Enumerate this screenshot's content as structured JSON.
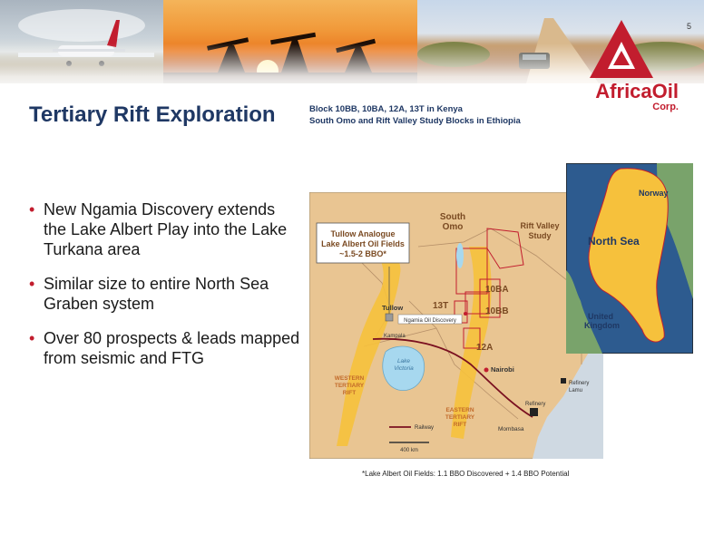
{
  "page": {
    "number": "5"
  },
  "logo": {
    "name_part1": "Africa",
    "name_part2": "Oil",
    "suffix": "Corp."
  },
  "header": {
    "title": "Tertiary Rift Exploration",
    "subtitle_line1": "Block 10BB, 10BA, 12A, 13T in Kenya",
    "subtitle_line2": "South Omo and Rift Valley Study Blocks in Ethiopia"
  },
  "bullets": [
    {
      "text": "New Ngamia Discovery extends the Lake Albert Play into the Lake Turkana area"
    },
    {
      "text": "Similar size to entire North Sea Graben system"
    },
    {
      "text": "Over 80 prospects & leads mapped from seismic and FTG"
    }
  ],
  "map": {
    "callout_line1": "Tullow Analogue",
    "callout_line2": "Lake Albert Oil Fields",
    "callout_line3": "~1.5-2 BBO*",
    "south_omo_1": "South",
    "south_omo_2": "Omo",
    "rift_valley_1": "Rift Valley",
    "rift_valley_2": "Study",
    "block_10ba": "10BA",
    "block_10bb": "10BB",
    "block_13t": "13T",
    "block_12a": "12A",
    "tullow": "Tullow",
    "ngamia": "Ngamia Oil Discovery",
    "kampala": "Kampala",
    "lake_victoria_1": "Lake",
    "lake_victoria_2": "Victoria",
    "nairobi": "Nairobi",
    "western_rift_1": "WESTERN",
    "western_rift_2": "TERTIARY",
    "western_rift_3": "RIFT",
    "eastern_rift_1": "EASTERN",
    "eastern_rift_2": "TERTIARY",
    "eastern_rift_3": "RIFT",
    "refinery_lamu_1": "Refinery",
    "refinery_lamu_2": "Lamu",
    "refinery_mombasa": "Refinery",
    "mombasa": "Mombasa",
    "railway": "Railway",
    "scale": "400 km"
  },
  "inset": {
    "norway": "Norway",
    "north_sea": "North Sea",
    "uk_1": "United",
    "uk_2": "Kingdom"
  },
  "footnote": "*Lake Albert Oil Fields:  1.1 BBO Discovered + 1.4 BBO Potential",
  "colors": {
    "title": "#1f3864",
    "brand": "#c21d2e",
    "basin": "#f6c13c",
    "land": "#e9c592"
  }
}
